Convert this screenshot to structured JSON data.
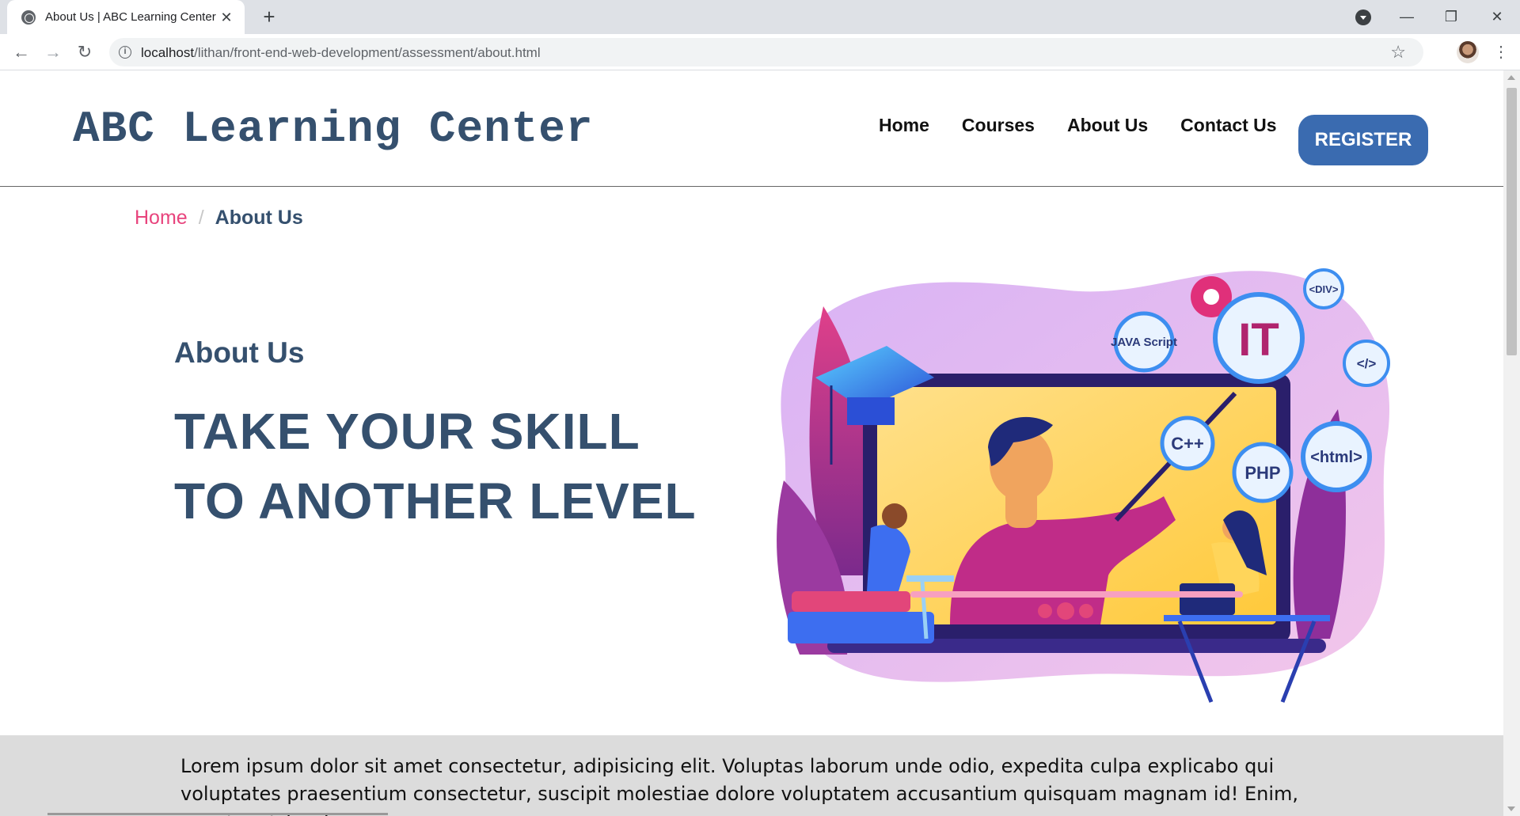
{
  "browser": {
    "tab_title": "About Us | ABC Learning Center",
    "url_host": "localhost",
    "url_path": "/lithan/front-end-web-development/assessment/about.html",
    "icons": [
      "globe-icon",
      "close-icon",
      "plus-icon",
      "back-icon",
      "forward-icon",
      "reload-icon",
      "info-icon",
      "star-icon",
      "menu-icon"
    ]
  },
  "site": {
    "logo": "ABC Learning Center",
    "nav": {
      "home": "Home",
      "courses": "Courses",
      "about": "About Us",
      "contact": "Contact Us",
      "register": "REGISTER"
    },
    "breadcrumb": {
      "home": "Home",
      "separator": "/",
      "current": "About Us"
    },
    "hero": {
      "heading": "About Us",
      "tagline_line1": "TAKE YOUR SKILL",
      "tagline_line2": "TO ANOTHER LEVEL",
      "bubbles": {
        "it": "IT",
        "java": "JAVA Script",
        "div": "<DIV>",
        "code": "</>",
        "cpp": "C++",
        "php": "PHP",
        "html": "<html>"
      }
    },
    "intro": "Lorem ipsum dolor sit amet consectetur, adipisicing elit. Voluptas laborum unde odio, expedita culpa explicabo qui voluptates praesentium consectetur, suscipit molestiae dolore voluptatem accusantium quisquam magnam id! Enim, sequi pariatur. Lorem"
  },
  "colors": {
    "brand": "#35506e",
    "accent": "#e8447d",
    "register": "#3a6bb0",
    "band": "#dcdcdc"
  }
}
